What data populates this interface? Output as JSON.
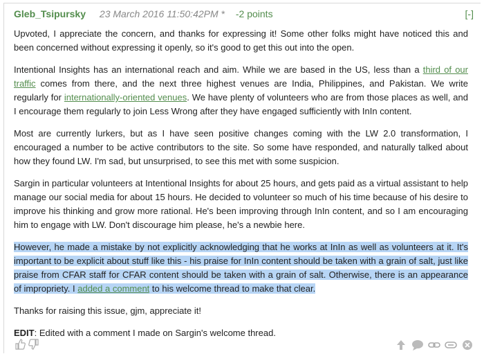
{
  "comment": {
    "author": "Gleb_Tsipursky",
    "date": "23 March 2016 11:50:42PM *",
    "points": "-2 points",
    "collapse": "[-]",
    "p1": "Upvoted, I appreciate the concern, and thanks for expressing it! Some other folks might have noticed this and been concerned without expressing it openly, so it's good to get this out into the open.",
    "p2": {
      "a": "Intentional Insights has an international reach and aim. While we are based in the US, less than a ",
      "link1": "third of our traffic",
      "b": " comes from there, and the next three highest venues are India, Philippines, and Pakistan. We write regularly for ",
      "link2": "internationally-oriented venues",
      "c": ". We have plenty of volunteers who are from those places as well, and I encourage them regularly to join Less Wrong after they have engaged sufficiently with InIn content."
    },
    "p3": "Most are currently lurkers, but as I have seen positive changes coming with the LW 2.0 transformation, I encouraged a number to be active contributors to the site. So some have responded, and naturally talked about how they found LW. I'm sad, but unsurprised, to see this met with some suspicion.",
    "p4": "Sargin in particular volunteers at Intentional Insights for about 25 hours, and gets paid as a virtual assistant to help manage our social media for about 15 hours. He decided to volunteer so much of his time because of his desire to improve his thinking and grow more rational. He's been improving through InIn content, and so I am encouraging him to engage with LW. Don't discourage him please, he's a newbie here.",
    "p5": {
      "a": "However, he made a mistake by not explicitly acknowledging that he works at InIn as well as volunteers at it. It's important to be explicit about stuff like this - his praise for InIn content should be taken with a grain of salt, just like praise from CFAR staff for CFAR content should be taken with a grain of salt. Otherwise, there is an appearance of impropriety. I ",
      "link": "added a comment",
      "b": " to his welcome thread to make that clear."
    },
    "p6": "Thanks for raising this issue, gjm, appreciate it!",
    "edit_label": "EDIT",
    "edit_text": ": Edited with a comment I made on Sargin's welcome thread."
  },
  "icons": {
    "left": [
      "thumbs-up-icon",
      "thumbs-down-icon"
    ],
    "right": [
      "parent-arrow-icon",
      "reply-icon",
      "permalink-icon",
      "edit-icon",
      "delete-icon"
    ]
  },
  "colors": {
    "accent": "#538d4d",
    "highlight": "#b7d5f5",
    "muted": "#888888"
  }
}
